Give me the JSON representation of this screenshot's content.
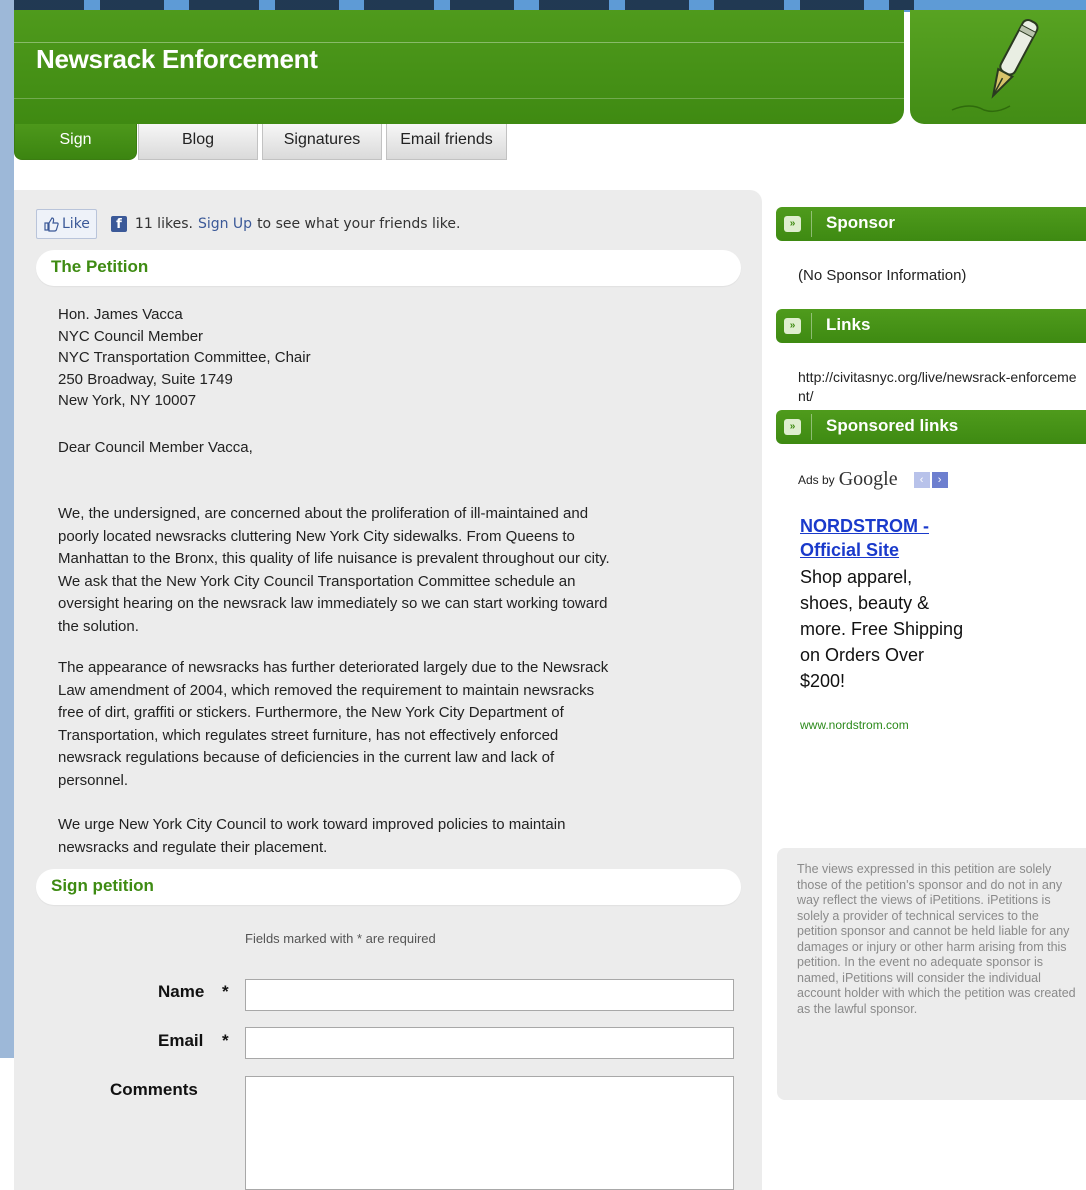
{
  "header": {
    "title": "Newsrack Enforcement"
  },
  "tabs": [
    {
      "label": "Sign",
      "active": true
    },
    {
      "label": "Blog",
      "active": false
    },
    {
      "label": "Signatures",
      "active": false
    },
    {
      "label": "Email friends",
      "active": false
    }
  ],
  "facebook": {
    "like_label": "Like",
    "likes_count_text": "11 likes.",
    "signup_link": "Sign Up",
    "suffix_text": "to see what your friends like."
  },
  "petition": {
    "section_title": "The Petition",
    "address_lines": [
      "Hon. James Vacca",
      "NYC Council Member",
      "NYC Transportation Committee, Chair",
      "250 Broadway, Suite 1749",
      "New York, NY 10007"
    ],
    "salutation": "Dear Council Member Vacca,",
    "paragraph1": "We, the undersigned, are concerned about the proliferation of ill-maintained and poorly located newsracks cluttering New York City sidewalks. From Queens to Manhattan to the Bronx, this quality of life nuisance is prevalent throughout our city. We ask that the New York City Council Transportation Committee schedule an oversight hearing on the newsrack law immediately so we can start working toward the solution.",
    "paragraph2": "The appearance of newsracks has further deteriorated largely due to the Newsrack Law amendment of 2004, which removed the requirement to maintain newsracks free of dirt, graffiti or stickers. Furthermore, the New York City Department of Transportation, which regulates street furniture, has not effectively enforced newsrack regulations because of deficiencies in the current law and lack of personnel.",
    "paragraph3": "We urge New York City Council to work toward improved policies to maintain newsracks and regulate their placement."
  },
  "sign_form": {
    "section_title": "Sign petition",
    "required_note": "Fields marked with * are required",
    "name_label": "Name",
    "email_label": "Email",
    "comments_label": "Comments",
    "required_marker": "*",
    "name_value": "",
    "email_value": "",
    "comments_value": ""
  },
  "sidebar": {
    "sponsor_title": "Sponsor",
    "sponsor_text": "(No Sponsor Information)",
    "links_title": "Links",
    "link_url": "http://civitasnyc.org/live/newsrack-enforcement/",
    "sponsored_links_title": "Sponsored links",
    "ads_by": "Ads by",
    "google": "Google",
    "ad_title": "NORDSTROM - Official Site",
    "ad_body": "Shop apparel, shoes, beauty & more. Free Shipping on Orders Over $200!",
    "ad_url": "www.nordstrom.com",
    "disclaimer": "The views expressed in this petition are solely those of the petition's sponsor and do not in any way reflect the views of iPetitions. iPetitions is solely a provider of technical services to the petition sponsor and cannot be held liable for any damages or injury or other harm arising from this petition. In the event no adequate sponsor is named, iPetitions will consider the individual account holder with which the petition was created as the lawful sponsor."
  },
  "colors": {
    "brand_green": "#3e8b12",
    "ad_link_blue": "#1a3acb",
    "facebook_blue": "#3b5998"
  },
  "icons": {
    "header_art": "fountain-pen-icon",
    "sidebar_bullet": "double-arrow-icon",
    "facebook": "facebook-icon",
    "like": "thumbs-up-icon"
  }
}
